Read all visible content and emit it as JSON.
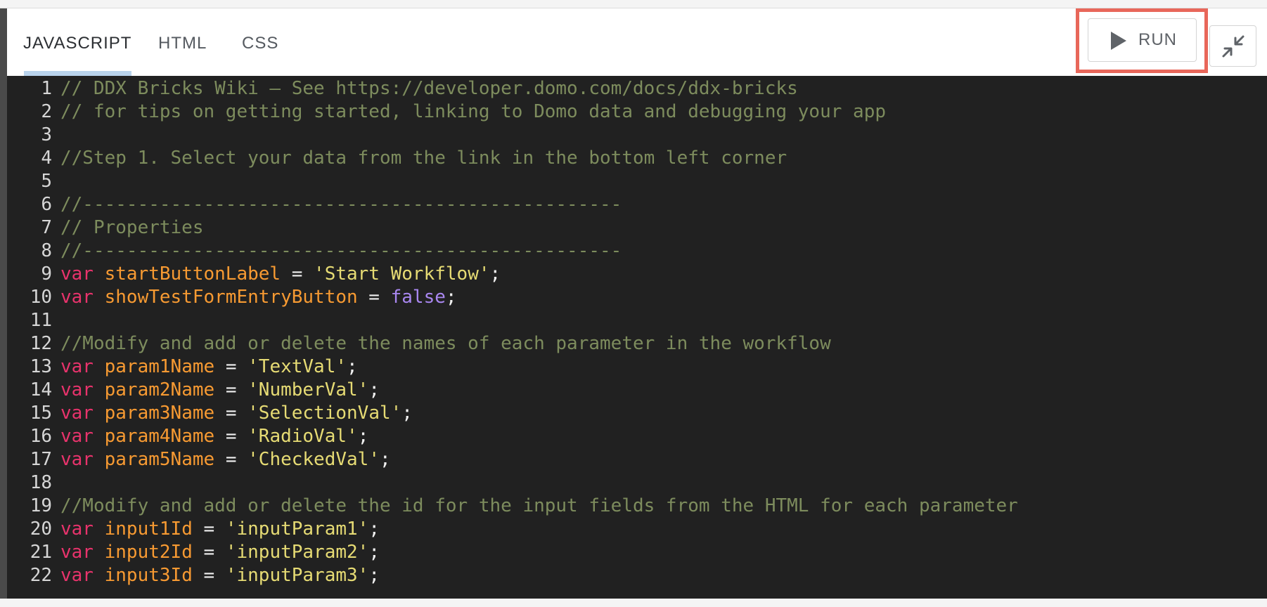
{
  "tabs": [
    {
      "label": "JAVASCRIPT",
      "active": true
    },
    {
      "label": "HTML",
      "active": false
    },
    {
      "label": "CSS",
      "active": false
    }
  ],
  "toolbar": {
    "run_label": "RUN",
    "run_icon": "play-icon",
    "collapse_icon": "collapse-arrows-icon"
  },
  "colors": {
    "highlight": "#e8675a",
    "editor_bg": "#212121",
    "comment": "#7d8c5d",
    "keyword": "#e8336c",
    "variable": "#f79a32",
    "string": "#e6db74",
    "boolean": "#a987f0"
  },
  "editor": {
    "lines": [
      {
        "num": "1",
        "tokens": [
          {
            "t": "comment",
            "v": "// DDX Bricks Wiki – See https://developer.domo.com/docs/ddx-bricks"
          }
        ]
      },
      {
        "num": "2",
        "tokens": [
          {
            "t": "comment",
            "v": "// for tips on getting started, linking to Domo data and debugging your app"
          }
        ]
      },
      {
        "num": "3",
        "tokens": []
      },
      {
        "num": "4",
        "tokens": [
          {
            "t": "comment",
            "v": "//Step 1. Select your data from the link in the bottom left corner"
          }
        ]
      },
      {
        "num": "5",
        "tokens": []
      },
      {
        "num": "6",
        "tokens": [
          {
            "t": "comment",
            "v": "//-------------------------------------------------"
          }
        ]
      },
      {
        "num": "7",
        "tokens": [
          {
            "t": "comment",
            "v": "// Properties"
          }
        ]
      },
      {
        "num": "8",
        "tokens": [
          {
            "t": "comment",
            "v": "//-------------------------------------------------"
          }
        ]
      },
      {
        "num": "9",
        "tokens": [
          {
            "t": "keyword",
            "v": "var"
          },
          {
            "t": "plain",
            "v": " "
          },
          {
            "t": "variable",
            "v": "startButtonLabel"
          },
          {
            "t": "plain",
            "v": " = "
          },
          {
            "t": "string",
            "v": "'Start Workflow'"
          },
          {
            "t": "plain",
            "v": ";"
          }
        ]
      },
      {
        "num": "10",
        "tokens": [
          {
            "t": "keyword",
            "v": "var"
          },
          {
            "t": "plain",
            "v": " "
          },
          {
            "t": "variable",
            "v": "showTestFormEntryButton"
          },
          {
            "t": "plain",
            "v": " = "
          },
          {
            "t": "bool",
            "v": "false"
          },
          {
            "t": "plain",
            "v": ";"
          }
        ]
      },
      {
        "num": "11",
        "tokens": []
      },
      {
        "num": "12",
        "tokens": [
          {
            "t": "comment",
            "v": "//Modify and add or delete the names of each parameter in the workflow"
          }
        ]
      },
      {
        "num": "13",
        "tokens": [
          {
            "t": "keyword",
            "v": "var"
          },
          {
            "t": "plain",
            "v": " "
          },
          {
            "t": "variable",
            "v": "param1Name"
          },
          {
            "t": "plain",
            "v": " = "
          },
          {
            "t": "string",
            "v": "'TextVal'"
          },
          {
            "t": "plain",
            "v": ";"
          }
        ]
      },
      {
        "num": "14",
        "tokens": [
          {
            "t": "keyword",
            "v": "var"
          },
          {
            "t": "plain",
            "v": " "
          },
          {
            "t": "variable",
            "v": "param2Name"
          },
          {
            "t": "plain",
            "v": " = "
          },
          {
            "t": "string",
            "v": "'NumberVal'"
          },
          {
            "t": "plain",
            "v": ";"
          }
        ]
      },
      {
        "num": "15",
        "tokens": [
          {
            "t": "keyword",
            "v": "var"
          },
          {
            "t": "plain",
            "v": " "
          },
          {
            "t": "variable",
            "v": "param3Name"
          },
          {
            "t": "plain",
            "v": " = "
          },
          {
            "t": "string",
            "v": "'SelectionVal'"
          },
          {
            "t": "plain",
            "v": ";"
          }
        ]
      },
      {
        "num": "16",
        "tokens": [
          {
            "t": "keyword",
            "v": "var"
          },
          {
            "t": "plain",
            "v": " "
          },
          {
            "t": "variable",
            "v": "param4Name"
          },
          {
            "t": "plain",
            "v": " = "
          },
          {
            "t": "string",
            "v": "'RadioVal'"
          },
          {
            "t": "plain",
            "v": ";"
          }
        ]
      },
      {
        "num": "17",
        "tokens": [
          {
            "t": "keyword",
            "v": "var"
          },
          {
            "t": "plain",
            "v": " "
          },
          {
            "t": "variable",
            "v": "param5Name"
          },
          {
            "t": "plain",
            "v": " = "
          },
          {
            "t": "string",
            "v": "'CheckedVal'"
          },
          {
            "t": "plain",
            "v": ";"
          }
        ]
      },
      {
        "num": "18",
        "tokens": []
      },
      {
        "num": "19",
        "tokens": [
          {
            "t": "comment",
            "v": "//Modify and add or delete the id for the input fields from the HTML for each parameter"
          }
        ]
      },
      {
        "num": "20",
        "tokens": [
          {
            "t": "keyword",
            "v": "var"
          },
          {
            "t": "plain",
            "v": " "
          },
          {
            "t": "variable",
            "v": "input1Id"
          },
          {
            "t": "plain",
            "v": " = "
          },
          {
            "t": "string",
            "v": "'inputParam1'"
          },
          {
            "t": "plain",
            "v": ";"
          }
        ]
      },
      {
        "num": "21",
        "tokens": [
          {
            "t": "keyword",
            "v": "var"
          },
          {
            "t": "plain",
            "v": " "
          },
          {
            "t": "variable",
            "v": "input2Id"
          },
          {
            "t": "plain",
            "v": " = "
          },
          {
            "t": "string",
            "v": "'inputParam2'"
          },
          {
            "t": "plain",
            "v": ";"
          }
        ]
      },
      {
        "num": "22",
        "tokens": [
          {
            "t": "keyword",
            "v": "var"
          },
          {
            "t": "plain",
            "v": " "
          },
          {
            "t": "variable",
            "v": "input3Id"
          },
          {
            "t": "plain",
            "v": " = "
          },
          {
            "t": "string",
            "v": "'inputParam3'"
          },
          {
            "t": "plain",
            "v": ";"
          }
        ]
      }
    ]
  }
}
